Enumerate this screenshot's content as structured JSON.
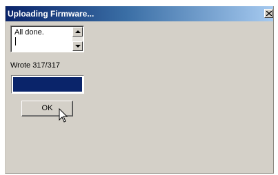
{
  "window": {
    "title": "Uploading Firmware...",
    "close_icon": "close-icon"
  },
  "log": {
    "text": "All done.",
    "scroll_up_icon": "arrow-up-icon",
    "scroll_down_icon": "arrow-down-icon"
  },
  "status": {
    "text": "Wrote 317/317"
  },
  "progress": {
    "fraction": 1.0,
    "fill_color": "#0a246a"
  },
  "buttons": {
    "ok_label": "OK"
  },
  "cursor": {
    "icon": "mouse-pointer-icon"
  },
  "colors": {
    "title_gradient_start": "#0a246a",
    "title_gradient_end": "#a6caf0",
    "dialog_bg": "#d4d0c8"
  }
}
